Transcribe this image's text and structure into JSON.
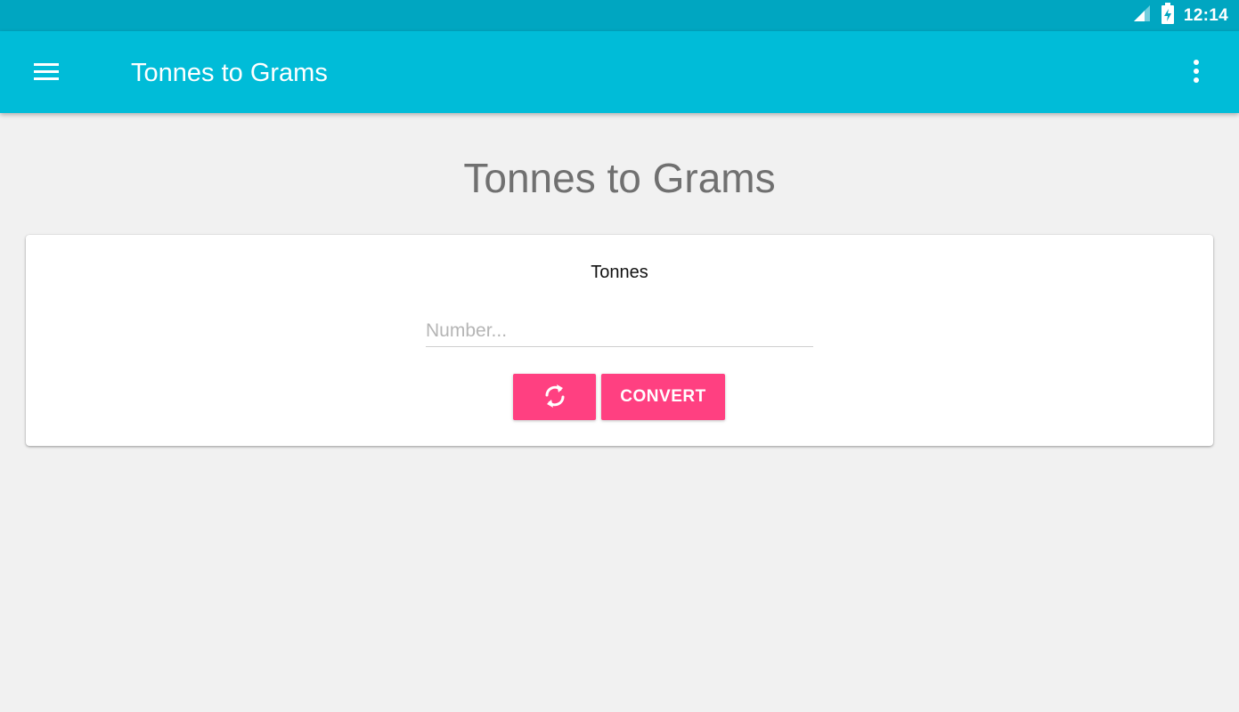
{
  "status_bar": {
    "time": "12:14",
    "icons": [
      "signal-icon",
      "battery-icon"
    ]
  },
  "app_bar": {
    "title": "Tonnes to Grams",
    "menu_icon": "hamburger-menu-icon",
    "overflow_icon": "more-vert-icon"
  },
  "page": {
    "heading": "Tonnes to Grams"
  },
  "converter": {
    "input_label": "Tonnes",
    "input_value": "",
    "input_placeholder": "Number...",
    "swap_icon": "refresh-icon",
    "convert_label": "CONVERT"
  },
  "colors": {
    "status_bar": "#00a6c1",
    "app_bar": "#00bcd8",
    "accent": "#ff4081",
    "background": "#f1f1f1"
  }
}
